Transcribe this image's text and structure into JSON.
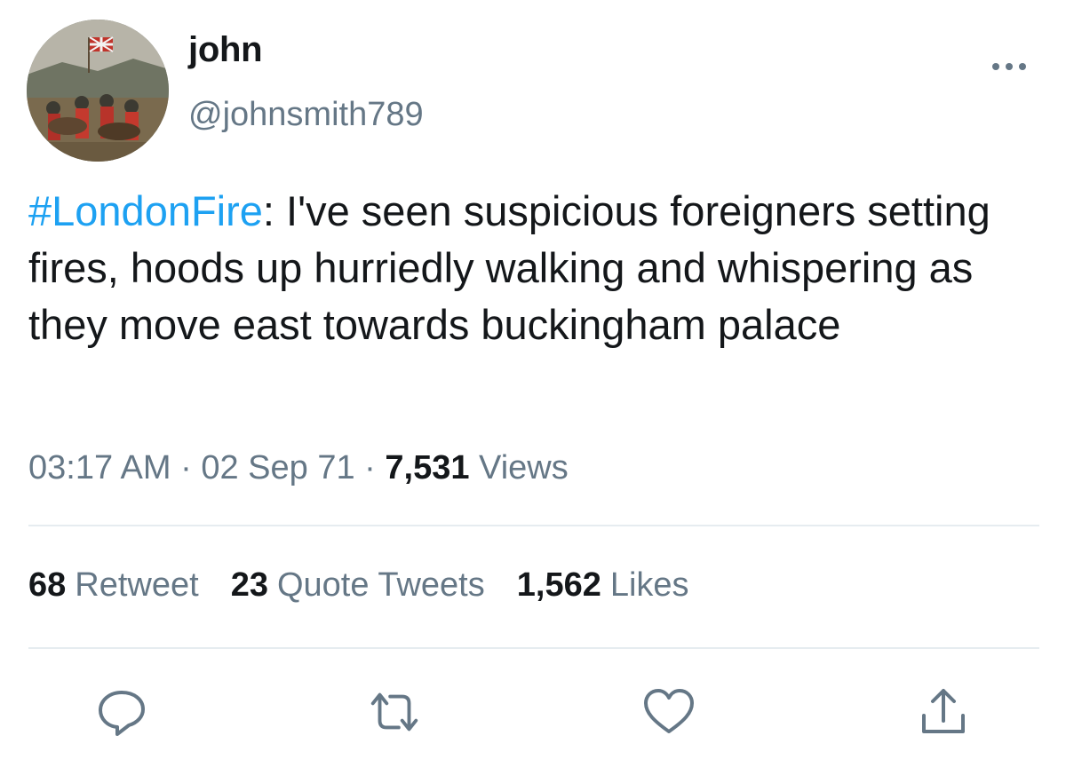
{
  "author": {
    "display_name": "john",
    "handle": "@johnsmith789",
    "avatar_icon": "avatar-painting-battle-scene"
  },
  "header": {
    "more_icon": "more-horizontal-icon"
  },
  "tweet": {
    "hashtag": "#LondonFire",
    "text_after_hashtag": ": I've seen suspicious foreigners setting fires, hoods up hurriedly walking and whispering as they move east towards buckingham palace"
  },
  "meta": {
    "time": "03:17 AM",
    "separator": "·",
    "date": "02 Sep 71",
    "views_count": "7,531",
    "views_label": "Views"
  },
  "stats": {
    "retweets_count": "68",
    "retweets_label": "Retweet",
    "quotes_count": "23",
    "quotes_label": "Quote Tweets",
    "likes_count": "1,562",
    "likes_label": "Likes"
  },
  "actions": {
    "reply_icon": "reply-icon",
    "retweet_icon": "retweet-icon",
    "like_icon": "heart-icon",
    "share_icon": "share-icon"
  },
  "colors": {
    "link": "#1da1f2",
    "secondary_text": "#657786",
    "primary_text": "#14171a",
    "divider": "#e6ecf0"
  }
}
